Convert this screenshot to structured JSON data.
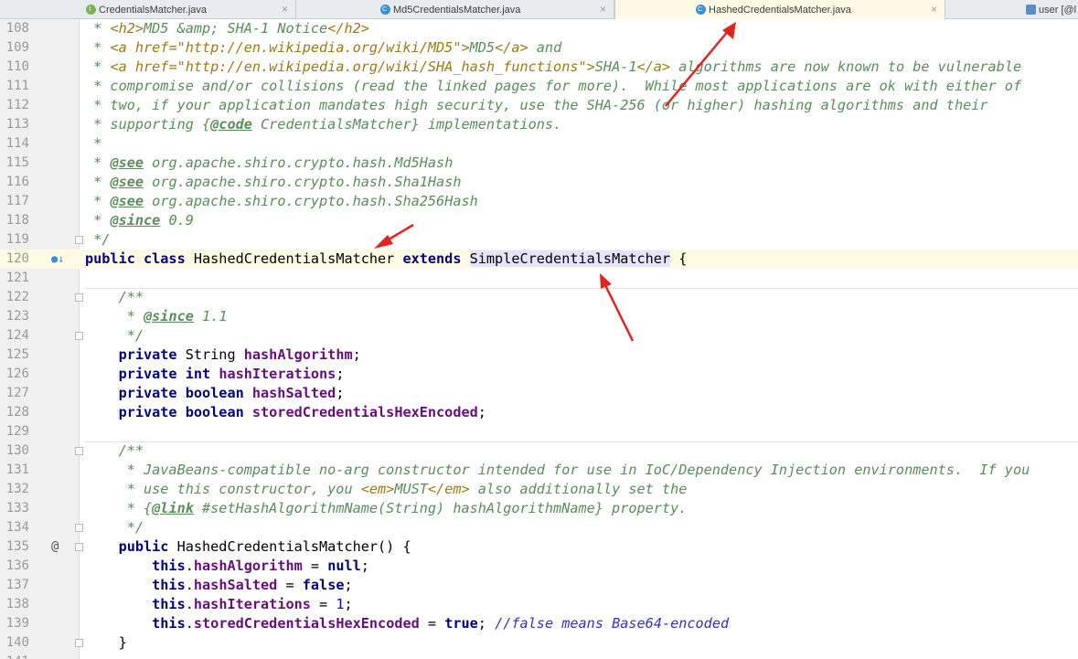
{
  "tabs": [
    {
      "label": "CredentialsMatcher.java",
      "icon": "interface-file-icon",
      "active": false
    },
    {
      "label": "Md5CredentialsMatcher.java",
      "icon": "class-file-icon",
      "active": false
    },
    {
      "label": "HashedCredentialsMatcher.java",
      "icon": "class-file-icon",
      "active": true
    },
    {
      "label": "user [@l",
      "icon": "table-icon",
      "active": false
    }
  ],
  "editor": {
    "lines": [
      {
        "n": "108",
        "segs": [
          [
            "c-doc",
            " * "
          ],
          [
            "c-html",
            "<h2>"
          ],
          [
            "c-doc",
            "MD5 &amp; SHA-1 Notice"
          ],
          [
            "c-html",
            "</h2>"
          ]
        ]
      },
      {
        "n": "109",
        "segs": [
          [
            "c-doc",
            " * "
          ],
          [
            "c-html",
            "<a href=\"http://en.wikipedia.org/wiki/MD5\">"
          ],
          [
            "c-doc",
            "MD5"
          ],
          [
            "c-html",
            "</a>"
          ],
          [
            "c-doc",
            " and"
          ]
        ]
      },
      {
        "n": "110",
        "segs": [
          [
            "c-doc",
            " * "
          ],
          [
            "c-html",
            "<a href=\"http://en.wikipedia.org/wiki/SHA_hash_functions\">"
          ],
          [
            "c-doc",
            "SHA-1"
          ],
          [
            "c-html",
            "</a>"
          ],
          [
            "c-doc",
            " algorithms are now known to be vulnerable"
          ]
        ]
      },
      {
        "n": "111",
        "segs": [
          [
            "c-doc",
            " * compromise and/or collisions (read the linked pages for more).  While most applications are ok with either of"
          ]
        ]
      },
      {
        "n": "112",
        "segs": [
          [
            "c-doc",
            " * two, if your application mandates high security, use the SHA-256 (or higher) hashing algorithms and their"
          ]
        ]
      },
      {
        "n": "113",
        "segs": [
          [
            "c-doc",
            " * supporting {"
          ],
          [
            "c-tag",
            "@code"
          ],
          [
            "c-doc",
            " CredentialsMatcher} implementations."
          ]
        ]
      },
      {
        "n": "114",
        "segs": [
          [
            "c-doc",
            " *"
          ]
        ]
      },
      {
        "n": "115",
        "segs": [
          [
            "c-doc",
            " * "
          ],
          [
            "c-tag",
            "@see"
          ],
          [
            "typ",
            " "
          ],
          [
            "c-doc",
            "org.apache.shiro.crypto.hash.Md5Hash"
          ]
        ]
      },
      {
        "n": "116",
        "segs": [
          [
            "c-doc",
            " * "
          ],
          [
            "c-tag",
            "@see"
          ],
          [
            "typ",
            " "
          ],
          [
            "c-doc",
            "org.apache.shiro.crypto.hash.Sha1Hash"
          ]
        ]
      },
      {
        "n": "117",
        "segs": [
          [
            "c-doc",
            " * "
          ],
          [
            "c-tag",
            "@see"
          ],
          [
            "typ",
            " "
          ],
          [
            "c-doc",
            "org.apache.shiro.crypto.hash.Sha256Hash"
          ]
        ]
      },
      {
        "n": "118",
        "segs": [
          [
            "c-doc",
            " * "
          ],
          [
            "c-tag",
            "@since"
          ],
          [
            "c-doc",
            " 0.9"
          ]
        ]
      },
      {
        "n": "119",
        "segs": [
          [
            "c-doc",
            " */"
          ]
        ]
      },
      {
        "n": "120",
        "segs": [
          [
            "kw",
            "public class "
          ],
          [
            "typ",
            "HashedCredentialsMatcher "
          ],
          [
            "kw",
            "extends "
          ],
          [
            "hl",
            "SimpleCredentialsMatcher"
          ],
          [
            "typ",
            " {"
          ]
        ]
      },
      {
        "n": "121",
        "segs": []
      },
      {
        "n": "122",
        "segs": [
          [
            "c-doc",
            "    /**"
          ]
        ]
      },
      {
        "n": "123",
        "segs": [
          [
            "c-doc",
            "     * "
          ],
          [
            "c-tag",
            "@since"
          ],
          [
            "c-doc",
            " 1.1"
          ]
        ]
      },
      {
        "n": "124",
        "segs": [
          [
            "c-doc",
            "     */"
          ]
        ]
      },
      {
        "n": "125",
        "segs": [
          [
            "kw",
            "    private "
          ],
          [
            "typ",
            "String "
          ],
          [
            "fld",
            "hashAlgorithm"
          ],
          [
            "typ",
            ";"
          ]
        ]
      },
      {
        "n": "126",
        "segs": [
          [
            "kw",
            "    private int "
          ],
          [
            "fld",
            "hashIterations"
          ],
          [
            "typ",
            ";"
          ]
        ]
      },
      {
        "n": "127",
        "segs": [
          [
            "kw",
            "    private boolean "
          ],
          [
            "fld",
            "hashSalted"
          ],
          [
            "typ",
            ";"
          ]
        ]
      },
      {
        "n": "128",
        "segs": [
          [
            "kw",
            "    private boolean "
          ],
          [
            "fld",
            "storedCredentialsHexEncoded"
          ],
          [
            "typ",
            ";"
          ]
        ]
      },
      {
        "n": "129",
        "segs": []
      },
      {
        "n": "130",
        "segs": [
          [
            "c-doc",
            "    /**"
          ]
        ]
      },
      {
        "n": "131",
        "segs": [
          [
            "c-doc",
            "     * JavaBeans-compatible no-arg constructor intended for use in IoC/Dependency Injection environments.  If you"
          ]
        ]
      },
      {
        "n": "132",
        "segs": [
          [
            "c-doc",
            "     * use this constructor, you "
          ],
          [
            "c-html",
            "<em>"
          ],
          [
            "c-doc",
            "MUST"
          ],
          [
            "c-html",
            "</em>"
          ],
          [
            "c-doc",
            " also additionally set the"
          ]
        ]
      },
      {
        "n": "133",
        "segs": [
          [
            "c-doc",
            "     * {"
          ],
          [
            "c-tag",
            "@link"
          ],
          [
            "c-doc",
            " #setHashAlgorithmName(String) hashAlgorithmName} property."
          ]
        ]
      },
      {
        "n": "134",
        "segs": [
          [
            "c-doc",
            "     */"
          ]
        ]
      },
      {
        "n": "135",
        "segs": [
          [
            "kw",
            "    public "
          ],
          [
            "typ",
            "HashedCredentialsMatcher() {"
          ]
        ]
      },
      {
        "n": "136",
        "segs": [
          [
            "kw",
            "        this"
          ],
          [
            "typ",
            "."
          ],
          [
            "fld",
            "hashAlgorithm"
          ],
          [
            "typ",
            " = "
          ],
          [
            "kw",
            "null"
          ],
          [
            "typ",
            ";"
          ]
        ]
      },
      {
        "n": "137",
        "segs": [
          [
            "kw",
            "        this"
          ],
          [
            "typ",
            "."
          ],
          [
            "fld",
            "hashSalted"
          ],
          [
            "typ",
            " = "
          ],
          [
            "kw",
            "false"
          ],
          [
            "typ",
            ";"
          ]
        ]
      },
      {
        "n": "138",
        "segs": [
          [
            "kw",
            "        this"
          ],
          [
            "typ",
            "."
          ],
          [
            "fld",
            "hashIterations"
          ],
          [
            "typ",
            " = "
          ],
          [
            "num",
            "1"
          ],
          [
            "typ",
            ";"
          ]
        ]
      },
      {
        "n": "139",
        "segs": [
          [
            "kw",
            "        this"
          ],
          [
            "typ",
            "."
          ],
          [
            "fld",
            "storedCredentialsHexEncoded"
          ],
          [
            "typ",
            " = "
          ],
          [
            "kw",
            "true"
          ],
          [
            "typ",
            "; "
          ],
          [
            "c-line",
            "//false means Base64-encoded"
          ]
        ]
      },
      {
        "n": "140",
        "segs": [
          [
            "typ",
            "    }"
          ]
        ]
      },
      {
        "n": "141",
        "segs": []
      }
    ],
    "gutter_icons": {
      "120": "●↓",
      "135": "@"
    },
    "caret_line": "120",
    "fold_lines": [
      "119",
      "122",
      "124",
      "130",
      "134",
      "135",
      "140"
    ],
    "separator_after": [
      "121",
      "129"
    ]
  },
  "accent_color": "#e0241f"
}
